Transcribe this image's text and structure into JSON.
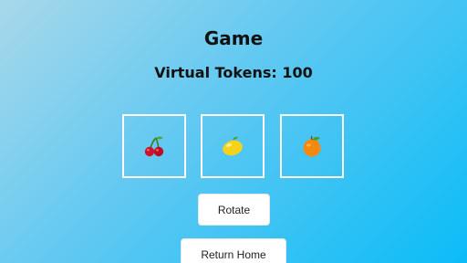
{
  "title": "Game",
  "tokens": {
    "label": "Virtual Tokens: 100",
    "value": 100
  },
  "reels": [
    {
      "icon": "cherry-icon"
    },
    {
      "icon": "lemon-icon"
    },
    {
      "icon": "orange-icon"
    }
  ],
  "buttons": {
    "rotate": "Rotate",
    "home": "Return Home"
  },
  "colors": {
    "background_start": "#a8d8ea",
    "background_end": "#0bbcf7",
    "reel_border": "#ffffff",
    "button_bg": "#ffffff"
  }
}
